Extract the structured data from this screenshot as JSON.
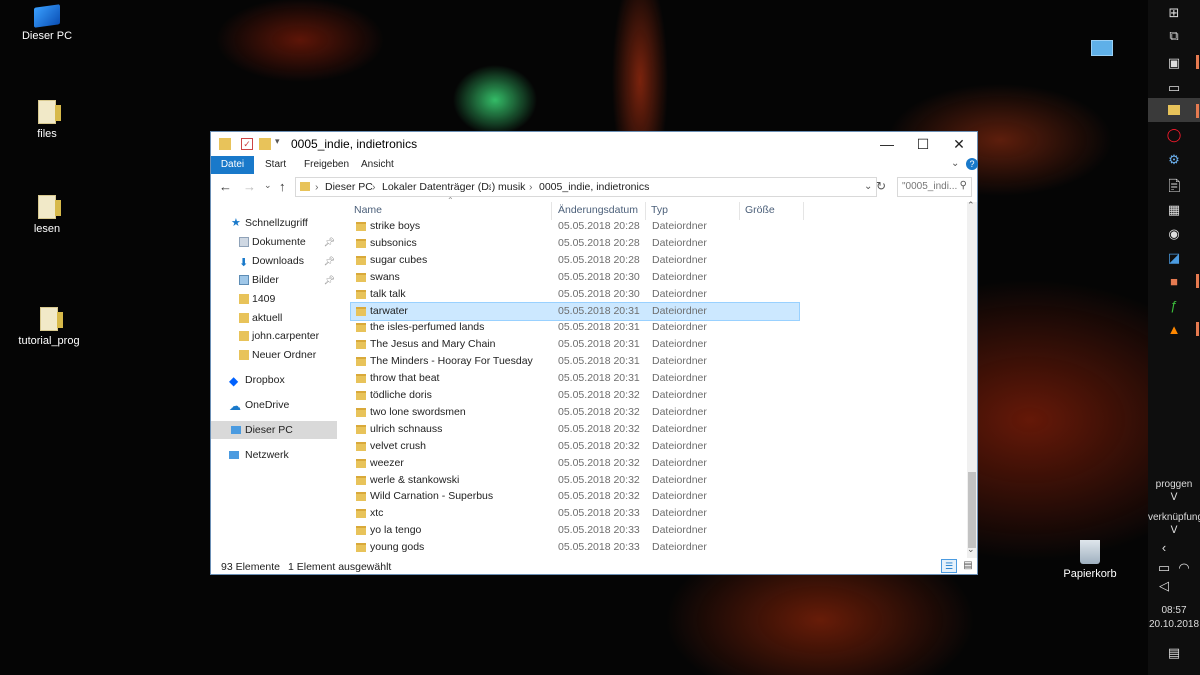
{
  "desktop": {
    "icons": [
      {
        "label": "Dieser PC"
      },
      {
        "label": "files"
      },
      {
        "label": "lesen"
      },
      {
        "label": "tutorial_prog"
      },
      {
        "label": "Papierkorb"
      }
    ]
  },
  "window": {
    "title": "0005_indie, indietronics",
    "controls": {
      "minimize": "—",
      "maximize": "☐",
      "close": "✕"
    },
    "ribbon_tabs": [
      "Datei",
      "Start",
      "Freigeben",
      "Ansicht"
    ],
    "breadcrumb": [
      "Dieser PC",
      "Lokaler Datenträger (D:)",
      "musik",
      "0005_indie, indietronics"
    ],
    "search_placeholder": "\"0005_indi...",
    "nav": [
      {
        "label": "Schnellzugriff",
        "icon": "star-icon"
      },
      {
        "label": "Dokumente",
        "icon": "documents-icon",
        "pinned": true
      },
      {
        "label": "Downloads",
        "icon": "downloads-icon",
        "pinned": true
      },
      {
        "label": "Bilder",
        "icon": "pictures-icon",
        "pinned": true
      },
      {
        "label": "1409",
        "icon": "folder-icon"
      },
      {
        "label": "aktuell",
        "icon": "folder-icon"
      },
      {
        "label": "john.carpenter",
        "icon": "folder-icon"
      },
      {
        "label": "Neuer Ordner",
        "icon": "folder-icon"
      },
      {
        "label": "Dropbox",
        "icon": "dropbox-icon"
      },
      {
        "label": "OneDrive",
        "icon": "onedrive-icon"
      },
      {
        "label": "Dieser PC",
        "icon": "pc-icon",
        "selected": true
      },
      {
        "label": "Netzwerk",
        "icon": "network-icon"
      }
    ],
    "columns": [
      "Name",
      "Änderungsdatum",
      "Typ",
      "Größe"
    ],
    "rows": [
      {
        "name": "strike boys",
        "date": "05.05.2018 20:28",
        "type": "Dateiordner"
      },
      {
        "name": "subsonics",
        "date": "05.05.2018 20:28",
        "type": "Dateiordner"
      },
      {
        "name": "sugar cubes",
        "date": "05.05.2018 20:28",
        "type": "Dateiordner"
      },
      {
        "name": "swans",
        "date": "05.05.2018 20:30",
        "type": "Dateiordner"
      },
      {
        "name": "talk talk",
        "date": "05.05.2018 20:30",
        "type": "Dateiordner"
      },
      {
        "name": "tarwater",
        "date": "05.05.2018 20:31",
        "type": "Dateiordner",
        "selected": true
      },
      {
        "name": "the isles-perfumed lands",
        "date": "05.05.2018 20:31",
        "type": "Dateiordner"
      },
      {
        "name": "The Jesus and Mary Chain",
        "date": "05.05.2018 20:31",
        "type": "Dateiordner"
      },
      {
        "name": "The Minders - Hooray For Tuesday",
        "date": "05.05.2018 20:31",
        "type": "Dateiordner"
      },
      {
        "name": "throw that beat",
        "date": "05.05.2018 20:31",
        "type": "Dateiordner"
      },
      {
        "name": "tödliche doris",
        "date": "05.05.2018 20:32",
        "type": "Dateiordner"
      },
      {
        "name": "two lone swordsmen",
        "date": "05.05.2018 20:32",
        "type": "Dateiordner"
      },
      {
        "name": "ulrich schnauss",
        "date": "05.05.2018 20:32",
        "type": "Dateiordner"
      },
      {
        "name": "velvet crush",
        "date": "05.05.2018 20:32",
        "type": "Dateiordner"
      },
      {
        "name": "weezer",
        "date": "05.05.2018 20:32",
        "type": "Dateiordner"
      },
      {
        "name": "werle & stankowski",
        "date": "05.05.2018 20:32",
        "type": "Dateiordner"
      },
      {
        "name": "Wild Carnation - Superbus",
        "date": "05.05.2018 20:32",
        "type": "Dateiordner"
      },
      {
        "name": "xtc",
        "date": "05.05.2018 20:33",
        "type": "Dateiordner"
      },
      {
        "name": "yo la tengo",
        "date": "05.05.2018 20:33",
        "type": "Dateiordner"
      },
      {
        "name": "young gods",
        "date": "05.05.2018 20:33",
        "type": "Dateiordner"
      }
    ],
    "status": {
      "count": "93 Elemente",
      "selection": "1 Element ausgewählt"
    }
  },
  "taskbar": {
    "text_labels": [
      "proggen",
      "verknüpfung"
    ],
    "clock_time": "08:57",
    "clock_date": "20.10.2018"
  },
  "colors": {
    "accent": "#1979ca",
    "selection": "#cce8ff",
    "taskbar": "#0e0e0e"
  }
}
